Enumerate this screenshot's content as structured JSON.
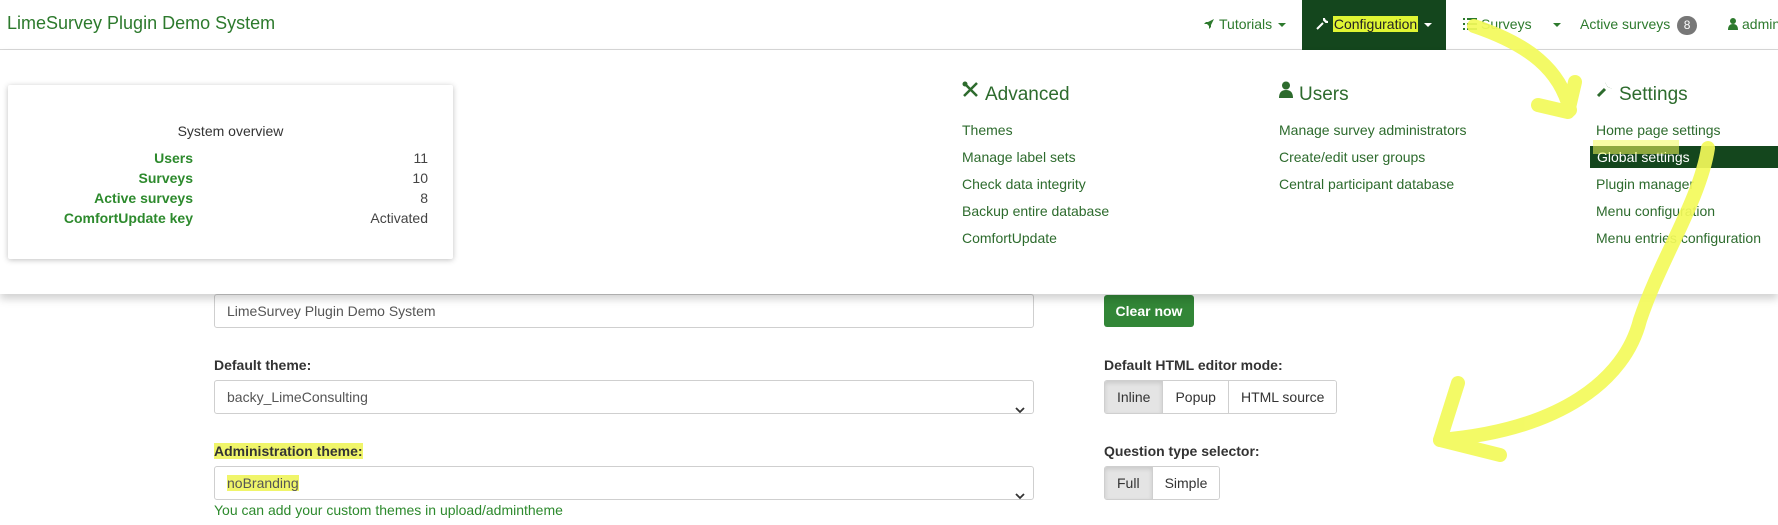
{
  "navbar": {
    "brand": "LimeSurvey Plugin Demo System",
    "tutorials": "Tutorials",
    "configuration": "Configuration",
    "surveys": "Surveys",
    "active_surveys": "Active surveys",
    "active_surveys_count": "8",
    "admin": "admin",
    "active_bg": "#14461d",
    "accent": "#2d7a2d"
  },
  "overview": {
    "title": "System overview",
    "rows": [
      {
        "label": "Users",
        "value": "11"
      },
      {
        "label": "Surveys",
        "value": "10"
      },
      {
        "label": "Active surveys",
        "value": "8"
      },
      {
        "label": "ComfortUpdate key",
        "value": "Activated"
      }
    ]
  },
  "menu": {
    "advanced": {
      "title": "Advanced",
      "icon": "tools-icon",
      "items": [
        "Themes",
        "Manage label sets",
        "Check data integrity",
        "Backup entire database",
        "ComfortUpdate"
      ]
    },
    "users": {
      "title": "Users",
      "icon": "user-icon",
      "items": [
        "Manage survey administrators",
        "Create/edit user groups",
        "Central participant database"
      ]
    },
    "settings": {
      "title": "Settings",
      "icon": "wrench-icon",
      "items": [
        "Home page settings",
        "Global settings",
        "Plugin manager",
        "Menu configuration",
        "Menu entries configuration"
      ],
      "active_index": 1
    }
  },
  "form": {
    "sitename_value": "LimeSurvey Plugin Demo System",
    "clear_button": "Clear now",
    "default_theme_label": "Default theme:",
    "default_theme_value": "backy_LimeConsulting",
    "admin_theme_label": "Administration theme:",
    "admin_theme_value": "noBranding",
    "admin_theme_help": "You can add your custom themes in upload/admintheme",
    "editor_mode_label": "Default HTML editor mode:",
    "editor_modes": [
      "Inline",
      "Popup",
      "HTML source"
    ],
    "editor_mode_selected": "Inline",
    "qtype_label": "Question type selector:",
    "qtype_options": [
      "Full",
      "Simple"
    ],
    "qtype_selected": "Full"
  },
  "colors": {
    "highlight_yellow": "#f0f56a",
    "button_green": "#328637",
    "annotation_yellow": "#f3fa5a"
  }
}
